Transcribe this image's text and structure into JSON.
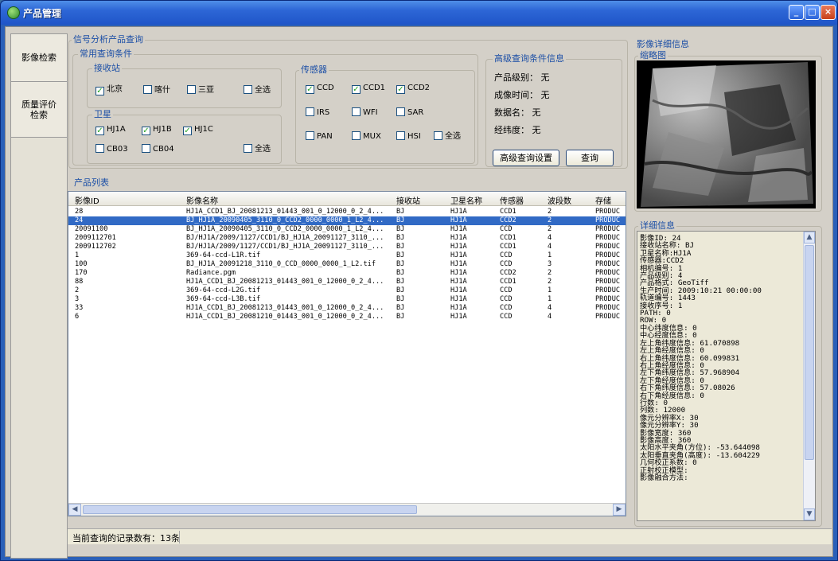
{
  "window": {
    "title": "产品管理"
  },
  "sidenav": [
    {
      "label": "影像检索"
    },
    {
      "label": "质量评价\n检索"
    }
  ],
  "query": {
    "title": "信号分析产品查询",
    "common_title": "常用查询条件",
    "station_title": "接收站",
    "stations": [
      {
        "label": "北京",
        "checked": true
      },
      {
        "label": "喀什",
        "checked": false
      },
      {
        "label": "三亚",
        "checked": false
      },
      {
        "label": "全选",
        "checked": false
      }
    ],
    "satellite_title": "卫星",
    "satellites": [
      {
        "label": "HJ1A",
        "checked": true
      },
      {
        "label": "HJ1B",
        "checked": true
      },
      {
        "label": "HJ1C",
        "checked": true
      },
      {
        "label": "CB03",
        "checked": false
      },
      {
        "label": "CB04",
        "checked": false
      },
      {
        "label": "全选",
        "checked": false
      }
    ],
    "sensor_title": "传感器",
    "sensors": [
      {
        "label": "CCD",
        "checked": true
      },
      {
        "label": "CCD1",
        "checked": true
      },
      {
        "label": "CCD2",
        "checked": true
      },
      {
        "label": "IRS",
        "checked": false
      },
      {
        "label": "WFI",
        "checked": false
      },
      {
        "label": "SAR",
        "checked": false
      },
      {
        "label": "PAN",
        "checked": false
      },
      {
        "label": "MUX",
        "checked": false
      },
      {
        "label": "HSI",
        "checked": false
      },
      {
        "label": "全选",
        "checked": false
      }
    ],
    "advanced_title": "高级查询条件信息",
    "advanced": [
      {
        "key": "产品级别：",
        "value": "无"
      },
      {
        "key": "成像时间：",
        "value": "无"
      },
      {
        "key": "数据名：",
        "value": "无"
      },
      {
        "key": "经纬度：",
        "value": "无"
      }
    ],
    "adv_button": "高级查询设置",
    "query_button": "查询"
  },
  "list": {
    "title": "产品列表",
    "columns": [
      "影像ID",
      "影像名称",
      "接收站",
      "卫星名称",
      "传感器",
      "波段数",
      "存储"
    ],
    "rows": [
      [
        "28",
        "HJ1A_CCD1_BJ_20081213_01443_001_0_12000_0_2_4...",
        "BJ",
        "HJ1A",
        "CCD1",
        "2",
        "PRODUC"
      ],
      [
        "24",
        "BJ_HJ1A_20090405_3110_0_CCD2_0000_0000_1_L2_4...",
        "BJ",
        "HJ1A",
        "CCD2",
        "2",
        "PRODUC"
      ],
      [
        "20091100",
        "BJ_HJ1A_20090405_3110_0_CCD2_0000_0000_1_L2_4...",
        "BJ",
        "HJ1A",
        "CCD",
        "2",
        "PRODUC"
      ],
      [
        "2009112701",
        "BJ/HJ1A/2009/1127/CCD1/BJ_HJ1A_20091127_3110_...",
        "BJ",
        "HJ1A",
        "CCD1",
        "4",
        "PRODUC"
      ],
      [
        "2009112702",
        "BJ/HJ1A/2009/1127/CCD1/BJ_HJ1A_20091127_3110_...",
        "BJ",
        "HJ1A",
        "CCD1",
        "4",
        "PRODUC"
      ],
      [
        "1",
        "369-64-ccd-L1R.tif",
        "BJ",
        "HJ1A",
        "CCD",
        "1",
        "PRODUC"
      ],
      [
        "100",
        "BJ_HJ1A_20091218_3110_0_CCD_0000_0000_1_L2.tif",
        "BJ",
        "HJ1A",
        "CCD",
        "3",
        "PRODUC"
      ],
      [
        "170",
        "Radiance.pgm",
        "BJ",
        "HJ1A",
        "CCD2",
        "2",
        "PRODUC"
      ],
      [
        "88",
        "HJ1A_CCD1_BJ_20081213_01443_001_0_12000_0_2_4...",
        "BJ",
        "HJ1A",
        "CCD1",
        "2",
        "PRODUC"
      ],
      [
        "2",
        "369-64-ccd-L2G.tif",
        "BJ",
        "HJ1A",
        "CCD",
        "1",
        "PRODUC"
      ],
      [
        "3",
        "369-64-ccd-L3B.tif",
        "BJ",
        "HJ1A",
        "CCD",
        "1",
        "PRODUC"
      ],
      [
        "33",
        "HJ1A_CCD1_BJ_20081213_01443_001_0_12000_0_2_4...",
        "BJ",
        "HJ1A",
        "CCD",
        "4",
        "PRODUC"
      ],
      [
        "6",
        "HJ1A_CCD1_BJ_20081210_01443_001_0_12000_0_2_4...",
        "BJ",
        "HJ1A",
        "CCD",
        "4",
        "PRODUC"
      ]
    ],
    "selected_index": 1
  },
  "status": {
    "text": "当前查询的记录数有：13条"
  },
  "detail": {
    "title": "影像详细信息",
    "thumb_title": "缩略图",
    "info_title": "详细信息",
    "lines": [
      "影像ID: 24",
      "接收站名称: BJ",
      "卫星名称:HJ1A",
      "传感器:CCD2",
      "相机编号: 1",
      "产品级别: 4",
      "产品格式: GeoTiff",
      "生产时间: 2009:10:21 00:00:00",
      "轨道编号: 1443",
      "接收序号: 1",
      "PATH: 0",
      "ROW: 0",
      "中心纬度信息: 0",
      "中心经度信息: 0",
      "左上角纬度信息: 61.070898",
      "左上角经度信息: 0",
      "右上角纬度信息: 60.099831",
      "右上角经度信息: 0",
      "左下角纬度信息: 57.968904",
      "左下角经度信息: 0",
      "右下角纬度信息: 57.08026",
      "右下角经度信息: 0",
      "行数: 0",
      "列数: 12000",
      "像元分辨率X: 30",
      "像元分辨率Y: 30",
      "影像宽度: 360",
      "影像高度: 360",
      "太阳水平夹角(方位): -53.644098",
      "太阳垂直夹角(高度): -13.604229",
      "几何校正系数: 0",
      "正射校正模型:",
      "影像融合方法:"
    ]
  }
}
